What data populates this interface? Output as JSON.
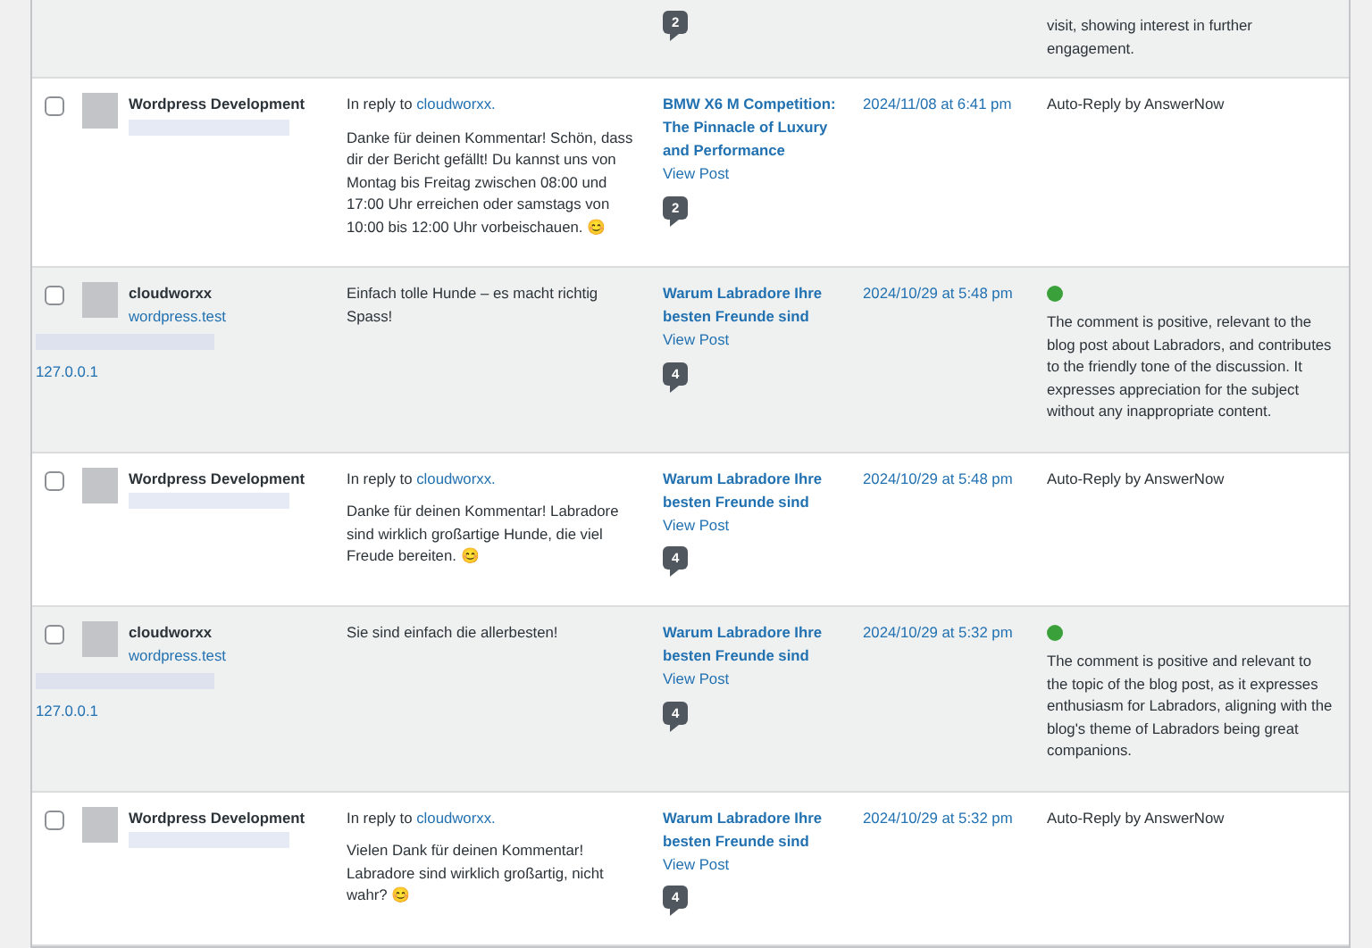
{
  "rows": [
    {
      "kind": "partial",
      "highlighted": true,
      "count": "2",
      "status_text": "visit, showing interest in further engagement."
    },
    {
      "kind": "reply",
      "highlighted": false,
      "checked": false,
      "author": "Wordpress Development",
      "reply_prefix": "In reply to",
      "reply_to": "cloudworxx.",
      "comment": "Danke für deinen Kommentar! Schön, dass dir der Bericht gefällt! Du kannst uns von Montag bis Freitag zwischen 08:00 und 17:00 Uhr erreichen oder samstags von 10:00 bis 12:00 Uhr vorbeischauen. 😊",
      "post": "BMW X6 M Competition: The Pinnacle of Luxury and Performance",
      "view": "View Post",
      "count": "2",
      "date": "2024/11/08 at 6:41 pm",
      "status_text": "Auto-Reply by AnswerNow"
    },
    {
      "kind": "comment",
      "highlighted": true,
      "checked": false,
      "author": "cloudworxx",
      "url": "wordpress.test",
      "ip": "127.0.0.1",
      "comment": "Einfach tolle Hunde – es macht richtig Spass!",
      "post": "Warum Labradore Ihre besten Freunde sind",
      "view": "View Post",
      "count": "4",
      "date": "2024/10/29 at 5:48 pm",
      "color": "#3aa13a",
      "status_text": "The comment is positive, relevant to the blog post about Labradors, and contributes to the friendly tone of the discussion. It expresses appreciation for the subject without any inappropriate content."
    },
    {
      "kind": "reply",
      "highlighted": false,
      "checked": false,
      "author": "Wordpress Development",
      "reply_prefix": "In reply to",
      "reply_to": "cloudworxx.",
      "comment": "Danke für deinen Kommentar! Labradore sind wirklich großartige Hunde, die viel Freude bereiten. 😊",
      "post": "Warum Labradore Ihre besten Freunde sind",
      "view": "View Post",
      "count": "4",
      "date": "2024/10/29 at 5:48 pm",
      "status_text": "Auto-Reply by AnswerNow"
    },
    {
      "kind": "comment",
      "highlighted": true,
      "checked": false,
      "author": "cloudworxx",
      "url": "wordpress.test",
      "ip": "127.0.0.1",
      "comment": "Sie sind einfach die allerbesten!",
      "post": "Warum Labradore Ihre besten Freunde sind",
      "view": "View Post",
      "count": "4",
      "date": "2024/10/29 at 5:32 pm",
      "color": "#3aa13a",
      "status_text": "The comment is positive and relevant to the topic of the blog post, as it expresses enthusiasm for Labradors, aligning with the blog's theme of Labradors being great companions."
    },
    {
      "kind": "reply",
      "highlighted": false,
      "checked": false,
      "author": "Wordpress Development",
      "reply_prefix": "In reply to",
      "reply_to": "cloudworxx.",
      "comment": "Vielen Dank für deinen Kommentar! Labradore sind wirklich großartig, nicht wahr? 😊",
      "post": "Warum Labradore Ihre besten Freunde sind",
      "view": "View Post",
      "count": "4",
      "date": "2024/10/29 at 5:32 pm",
      "status_text": "Auto-Reply by AnswerNow"
    }
  ]
}
